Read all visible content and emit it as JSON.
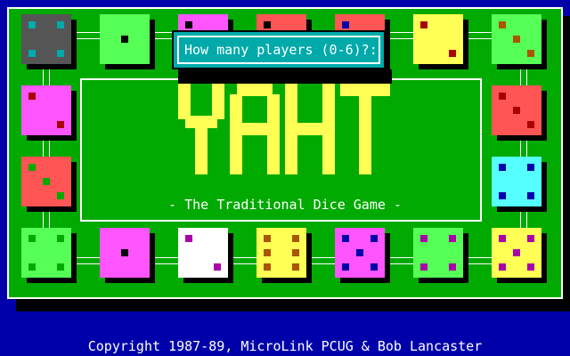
{
  "colors": {
    "background": "#0000aa",
    "board": "#00aa00",
    "title": "#ffff55",
    "dialog": "#00aaaa"
  },
  "title": "YAHT",
  "subtitle": "- The Traditional Dice Game -",
  "prompt": {
    "question": "How many players (0-6)?:",
    "input_value": ""
  },
  "copyright": "Copyright 1987-89, MicroLink PCUG & Bob Lancaster",
  "dice": [
    {
      "face": 4,
      "color": "#555555",
      "pip_color": "#00aaaa"
    },
    {
      "face": 1,
      "color": "#55ff55",
      "pip_color": "#000000"
    },
    {
      "face": 2,
      "color": "#ff55ff",
      "pip_color": "#000000"
    },
    {
      "face": 2,
      "color": "#ff5555",
      "pip_color": "#000000"
    },
    {
      "face": 2,
      "color": "#ff5555",
      "pip_color": "#0000aa"
    },
    {
      "face": 2,
      "color": "#ffff55",
      "pip_color": "#aa0000"
    },
    {
      "face": 3,
      "color": "#55ff55",
      "pip_color": "#aa5500"
    },
    {
      "face": 3,
      "color": "#ff5555",
      "pip_color": "#aa0000"
    },
    {
      "face": 4,
      "color": "#55ffff",
      "pip_color": "#0000aa"
    },
    {
      "face": 2,
      "color": "#ff55ff",
      "pip_color": "#aa0000"
    },
    {
      "face": 3,
      "color": "#ff5555",
      "pip_color": "#00aa00"
    },
    {
      "face": 4,
      "color": "#55ff55",
      "pip_color": "#00aa00"
    },
    {
      "face": 1,
      "color": "#ff55ff",
      "pip_color": "#000000"
    },
    {
      "face": 2,
      "color": "#ffffff",
      "pip_color": "#aa00aa"
    },
    {
      "face": 6,
      "color": "#ffff55",
      "pip_color": "#aa5500"
    },
    {
      "face": 5,
      "color": "#ff55ff",
      "pip_color": "#0000aa"
    },
    {
      "face": 4,
      "color": "#55ff55",
      "pip_color": "#aa00aa"
    },
    {
      "face": 5,
      "color": "#ffff55",
      "pip_color": "#aa00aa"
    }
  ]
}
